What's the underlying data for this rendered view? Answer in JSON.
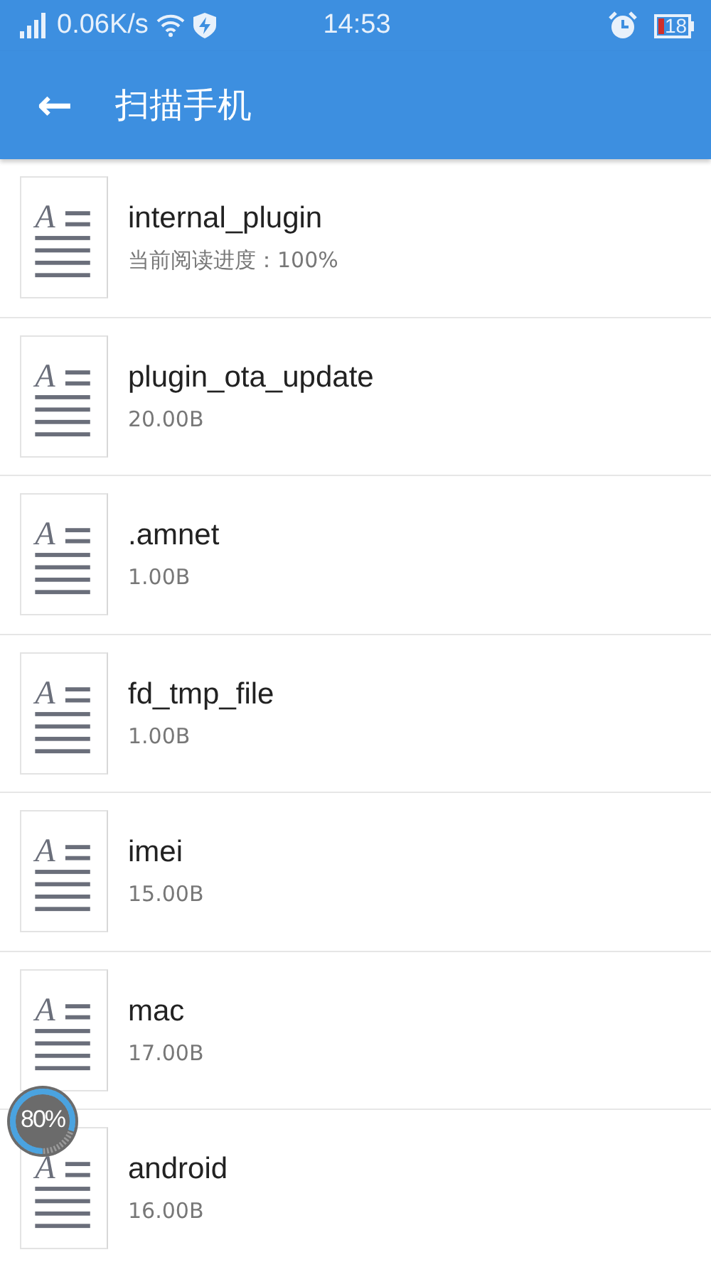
{
  "status_bar": {
    "net_speed": "0.06K/s",
    "time": "14:53",
    "battery": "18"
  },
  "app_bar": {
    "back": "←",
    "title": "扫描手机"
  },
  "files": [
    {
      "icon_letter": "A",
      "name": "internal_plugin",
      "detail": "当前阅读进度：100%"
    },
    {
      "icon_letter": "A",
      "name": "plugin_ota_update",
      "detail": "20.00B"
    },
    {
      "icon_letter": "A",
      "name": ".amnet",
      "detail": "1.00B"
    },
    {
      "icon_letter": "A",
      "name": "fd_tmp_file",
      "detail": "1.00B"
    },
    {
      "icon_letter": "A",
      "name": "imei",
      "detail": "15.00B"
    },
    {
      "icon_letter": "A",
      "name": "mac",
      "detail": "17.00B"
    },
    {
      "icon_letter": "A",
      "name": "android",
      "detail": "16.00B"
    }
  ],
  "floating_meter": {
    "reading": "80%",
    "level": 0.8
  }
}
